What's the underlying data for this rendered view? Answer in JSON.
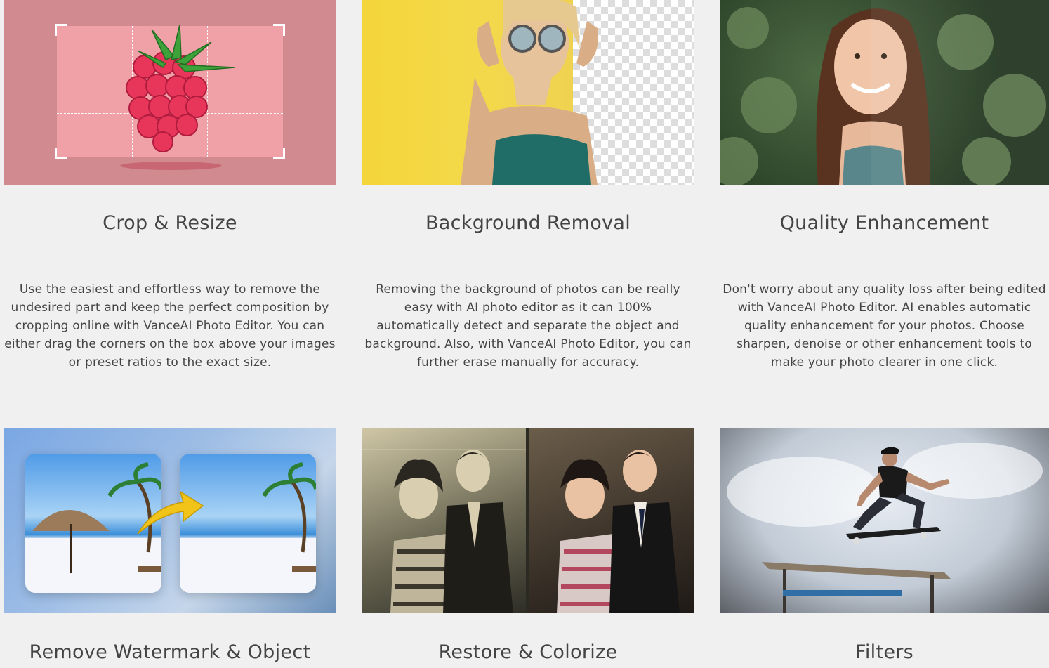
{
  "cards": [
    {
      "title": "Crop & Resize",
      "description": "Use the easiest and effortless way to remove the undesired part and keep the perfect composition by cropping online with VanceAI Photo Editor. You can either drag the corners on the box above your images or preset ratios to the exact size."
    },
    {
      "title": "Background Removal",
      "description": "Removing the background of photos can be really easy with AI photo editor as it can 100% automatically detect and separate the object and background. Also, with VanceAI Photo Editor, you can further erase manually for accuracy."
    },
    {
      "title": "Quality Enhancement",
      "description": "Don't worry about any quality loss after being edited with VanceAI Photo Editor. AI enables automatic quality enhancement for your photos. Choose sharpen, denoise or other enhancement tools to make your photo clearer in one click."
    },
    {
      "title": "Remove Watermark & Object"
    },
    {
      "title": "Restore & Colorize"
    },
    {
      "title": "Filters"
    }
  ],
  "thumbnails": {
    "crop": "raspberry-crop-illustration",
    "background": "woman-sunglasses-transparent-background",
    "quality": "smiling-woman-portrait",
    "watermark": "beach-umbrella-before-after",
    "restore": "old-couple-photo-before-after",
    "filters": "skateboarder-jump"
  }
}
